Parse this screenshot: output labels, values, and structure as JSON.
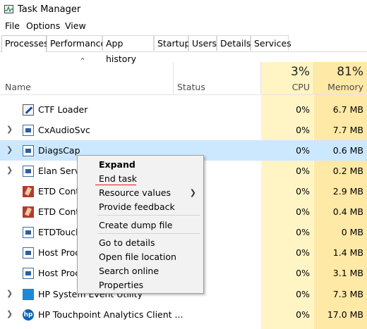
{
  "window": {
    "title": "Task Manager"
  },
  "menu": [
    "File",
    "Options",
    "View"
  ],
  "tabs": [
    "Processes",
    "Performance",
    "App history",
    "Startup",
    "Users",
    "Details",
    "Services"
  ],
  "header": {
    "name": "Name",
    "status": "Status",
    "cpu_label": "CPU",
    "cpu_pct": "3%",
    "mem_label": "Memory",
    "mem_pct": "81%"
  },
  "rows": [
    {
      "name": "CTF Loader",
      "cpu": "0%",
      "mem": "6.7 MB",
      "icon": "ctf-icon",
      "expandable": false
    },
    {
      "name": "CxAudioSvc",
      "cpu": "0%",
      "mem": "7.7 MB",
      "icon": "window-icon",
      "expandable": true
    },
    {
      "name": "DiagsCap",
      "cpu": "0%",
      "mem": "0.6 MB",
      "icon": "window-icon",
      "expandable": true,
      "selected": true
    },
    {
      "name": "Elan Servic",
      "cpu": "0%",
      "mem": "0.2 MB",
      "icon": "window-icon",
      "expandable": true
    },
    {
      "name": "ETD Contr",
      "cpu": "0%",
      "mem": "2.9 MB",
      "icon": "etd-icon",
      "expandable": false
    },
    {
      "name": "ETD Contr",
      "cpu": "0%",
      "mem": "0.4 MB",
      "icon": "etd-icon",
      "expandable": false
    },
    {
      "name": "ETDTouch",
      "cpu": "0%",
      "mem": "0 MB",
      "icon": "window-icon",
      "expandable": false
    },
    {
      "name": "Host Proce",
      "cpu": "0%",
      "mem": "1.4 MB",
      "icon": "window-icon",
      "expandable": false
    },
    {
      "name": "Host Proce",
      "cpu": "0%",
      "mem": "3.1 MB",
      "icon": "window-icon",
      "expandable": false
    },
    {
      "name": "HP System Event Utility",
      "cpu": "0%",
      "mem": "7.3 MB",
      "icon": "blue-icon",
      "expandable": true
    },
    {
      "name": "HP Touchpoint Analytics Client ...",
      "cpu": "0%",
      "mem": "17.0 MB",
      "icon": "hp-icon",
      "expandable": true
    }
  ],
  "context_menu": {
    "items": [
      "Expand",
      "End task",
      "Resource values",
      "Provide feedback",
      "Create dump file",
      "Go to details",
      "Open file location",
      "Search online",
      "Properties"
    ]
  },
  "colors": {
    "cpu_col": "#fff4c4",
    "mem_col": "#ffe9a6",
    "selected_row": "#cce8ff",
    "end_task_underline": "#e11111"
  }
}
